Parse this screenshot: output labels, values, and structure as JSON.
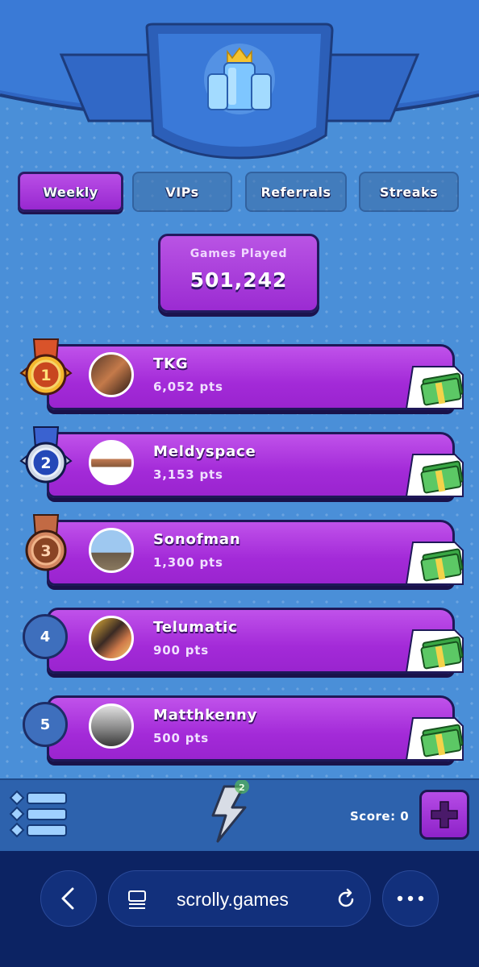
{
  "tabs": [
    {
      "label": "Weekly",
      "active": true
    },
    {
      "label": "VIPs",
      "active": false
    },
    {
      "label": "Referrals",
      "active": false
    },
    {
      "label": "Streaks",
      "active": false
    }
  ],
  "games_played": {
    "label": "Games Played",
    "value": "501,242"
  },
  "leaderboard": [
    {
      "rank": "1",
      "name": "TKG",
      "points": "6,052 pts",
      "badge": "gold-medal-icon"
    },
    {
      "rank": "2",
      "name": "Meldyspace",
      "points": "3,153 pts",
      "badge": "silver-medal-icon"
    },
    {
      "rank": "3",
      "name": "Sonofman",
      "points": "1,300 pts",
      "badge": "bronze-medal-icon"
    },
    {
      "rank": "4",
      "name": "Telumatic",
      "points": "900 pts",
      "badge": "rank-circle"
    },
    {
      "rank": "5",
      "name": "Matthkenny",
      "points": "500 pts",
      "badge": "rank-circle"
    }
  ],
  "gamebar": {
    "score_label": "Score: 0",
    "energy_badge": "2"
  },
  "browser": {
    "url": "scrolly.games"
  },
  "colors": {
    "accent_purple": "#a32ad8",
    "background_blue": "#4a8fd8",
    "browser_bg": "#0c2363"
  }
}
